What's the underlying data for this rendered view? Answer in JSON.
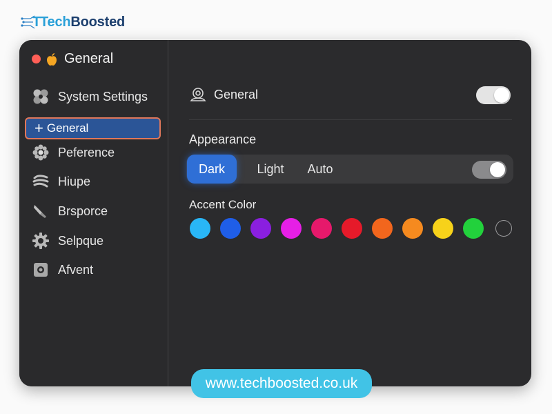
{
  "brand": {
    "part1": "Tech",
    "part2": "Boosted"
  },
  "window": {
    "title": "General"
  },
  "sidebar": {
    "items": [
      {
        "label": "System Settings",
        "icon": "system-settings-icon"
      },
      {
        "label": "General",
        "icon": "plus-icon",
        "active": true
      },
      {
        "label": "Peference",
        "icon": "flower-icon"
      },
      {
        "label": "Hiupe",
        "icon": "waves-icon"
      },
      {
        "label": "Brsporce",
        "icon": "brush-icon"
      },
      {
        "label": "Selpque",
        "icon": "gear-icon"
      },
      {
        "label": "Afvent",
        "icon": "frame-icon"
      }
    ]
  },
  "main": {
    "general_label": "General",
    "general_toggle_on": true,
    "appearance_label": "Appearance",
    "appearance_options": [
      "Dark",
      "Light",
      "Auto"
    ],
    "appearance_selected": "Dark",
    "appearance_toggle_on": true,
    "accent_label": "Accent Color",
    "accent_colors": [
      "#29b6f6",
      "#1f5ee8",
      "#8a1fe0",
      "#e61fe6",
      "#e6196b",
      "#e61a2a",
      "#f2661d",
      "#f58a1f",
      "#f7d21a",
      "#22d13c",
      "none"
    ]
  },
  "footer": {
    "url": "www.techboosted.co.uk"
  },
  "colors": {
    "accent_blue": "#2f6fd6",
    "active_sidebar": "#2b5597",
    "url_badge": "#41c3e6"
  }
}
